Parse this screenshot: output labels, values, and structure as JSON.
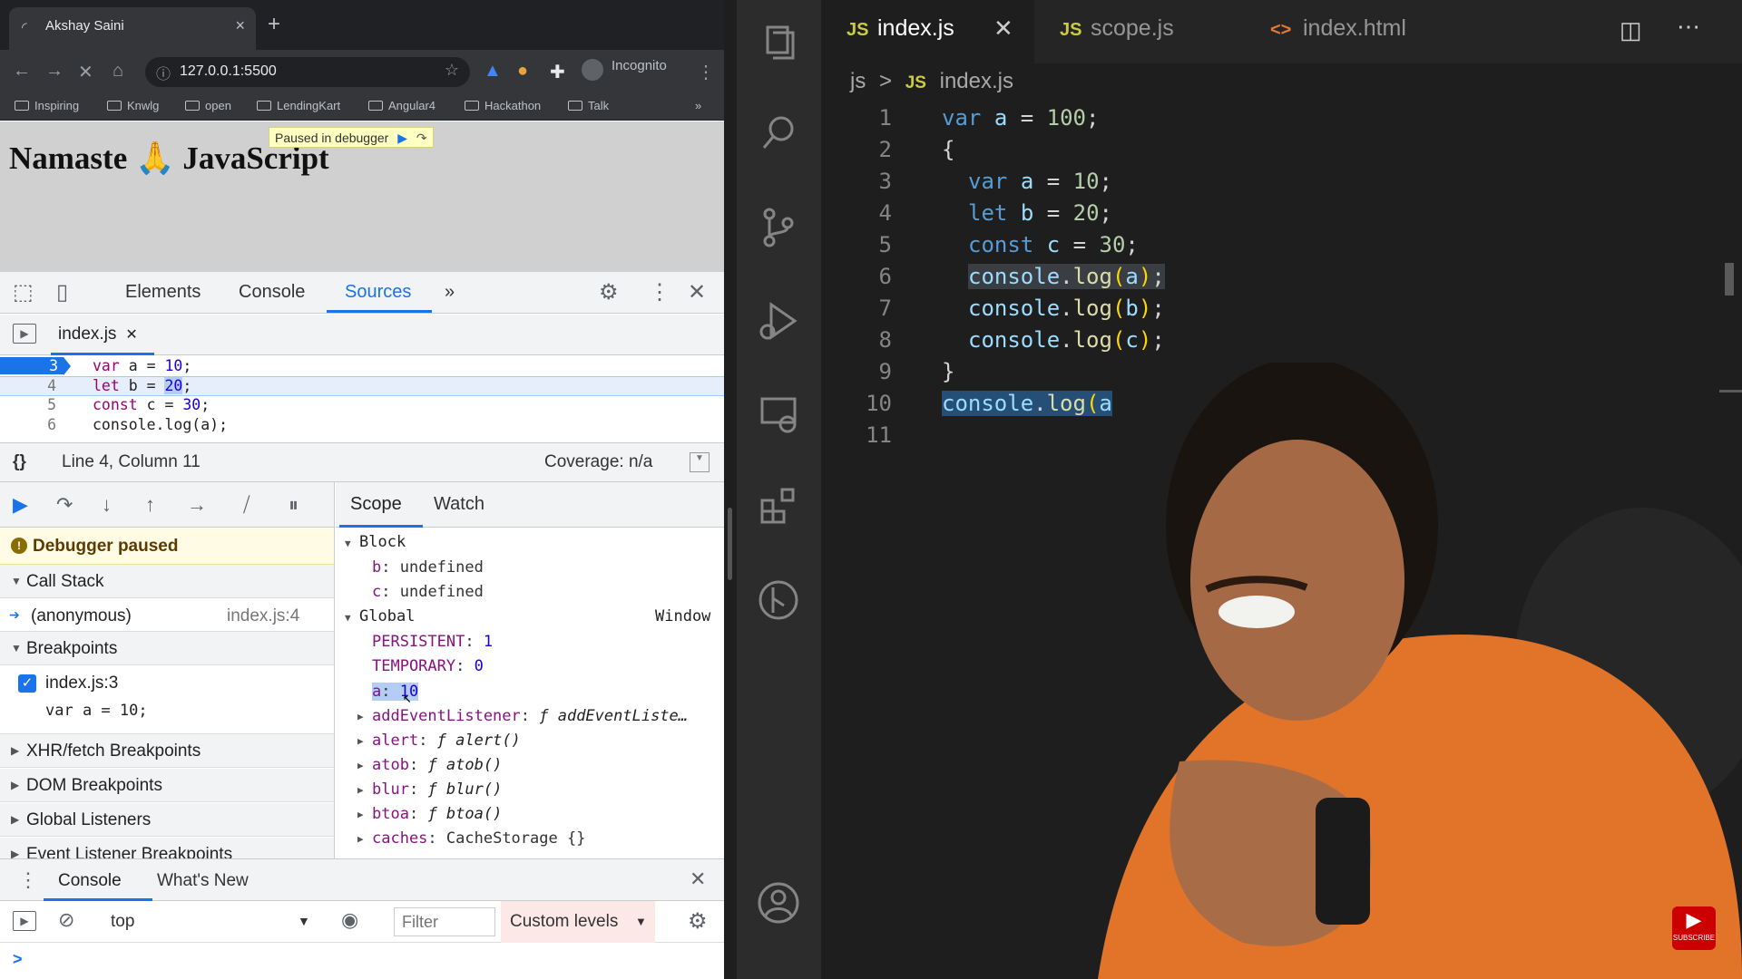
{
  "browser": {
    "tab_title": "Akshay Saini",
    "url": "127.0.0.1:5500",
    "profile": "Incognito",
    "bookmarks": [
      "Inspiring",
      "Knwlg",
      "open",
      "LendingKart",
      "Angular4",
      "Hackathon",
      "Talk"
    ],
    "more_bookmarks": "»"
  },
  "page": {
    "heading": "Namaste 🙏 JavaScript",
    "paused_banner": "Paused in debugger"
  },
  "devtools": {
    "tabs": [
      "Elements",
      "Console",
      "Sources"
    ],
    "more_tabs": "»",
    "file_tab": "index.js",
    "code_lines": [
      {
        "line": "3",
        "text_kw": "var",
        "text_rest": " a = ",
        "num": "10",
        "tail": ";"
      },
      {
        "line": "4",
        "text_kw": "let",
        "text_rest": " b = ",
        "num": "20",
        "tail": ";"
      },
      {
        "line": "5",
        "text_kw": "const",
        "text_rest": " c = ",
        "num": "30",
        "tail": ";"
      },
      {
        "line": "6",
        "text_kw": "",
        "text_rest": "console.log(a);",
        "num": "",
        "tail": ""
      }
    ],
    "status": {
      "braces": "{}",
      "position": "Line 4, Column 11",
      "coverage": "Coverage: n/a"
    },
    "debugger": {
      "paused_label": "Debugger paused",
      "call_stack_title": "Call Stack",
      "call_stack_frame": "(anonymous)",
      "call_stack_loc": "index.js:4",
      "breakpoints_title": "Breakpoints",
      "breakpoint_file": "index.js:3",
      "breakpoint_code": "var a = 10;",
      "sections": [
        "XHR/fetch Breakpoints",
        "DOM Breakpoints",
        "Global Listeners",
        "Event Listener Breakpoints"
      ]
    },
    "scope": {
      "tabs": [
        "Scope",
        "Watch"
      ],
      "block_title": "Block",
      "block_vars": [
        {
          "k": "b",
          "v": "undefined"
        },
        {
          "k": "c",
          "v": "undefined"
        }
      ],
      "global_title": "Global",
      "global_type": "Window",
      "global_vars": [
        {
          "k": "PERSISTENT",
          "v": "1"
        },
        {
          "k": "TEMPORARY",
          "v": "0"
        },
        {
          "k": "a",
          "v": "10"
        }
      ],
      "global_fns": [
        {
          "k": "addEventListener",
          "v": "ƒ addEventListe…"
        },
        {
          "k": "alert",
          "v": "ƒ alert()"
        },
        {
          "k": "atob",
          "v": "ƒ atob()"
        },
        {
          "k": "blur",
          "v": "ƒ blur()"
        },
        {
          "k": "btoa",
          "v": "ƒ btoa()"
        },
        {
          "k": "caches",
          "v": "CacheStorage {}"
        }
      ]
    },
    "drawer": {
      "tabs": [
        "Console",
        "What's New"
      ],
      "context": "top",
      "filter_placeholder": "Filter",
      "levels": "Custom levels",
      "prompt": ">"
    }
  },
  "vscode": {
    "tabs": [
      {
        "icon": "JS",
        "label": "index.js"
      },
      {
        "icon": "JS",
        "label": "scope.js"
      },
      {
        "icon": "<>",
        "label": "index.html"
      }
    ],
    "breadcrumb": {
      "folder": "js",
      "sep": ">",
      "icon": "JS",
      "file": "index.js"
    },
    "line_numbers": [
      "1",
      "2",
      "3",
      "4",
      "5",
      "6",
      "7",
      "8",
      "9",
      "10",
      "11"
    ],
    "code": {
      "l1": "var a = 100;",
      "l2": "{",
      "l3": "var a = 10;",
      "l4": "let b = 20;",
      "l5": "const c = 30;",
      "l6": "console.log(a);",
      "l7": "console.log(b);",
      "l8": "console.log(c);",
      "l9": "}",
      "l10": "console.log(a"
    }
  },
  "youtube_badge": "SUBSCRIBE"
}
